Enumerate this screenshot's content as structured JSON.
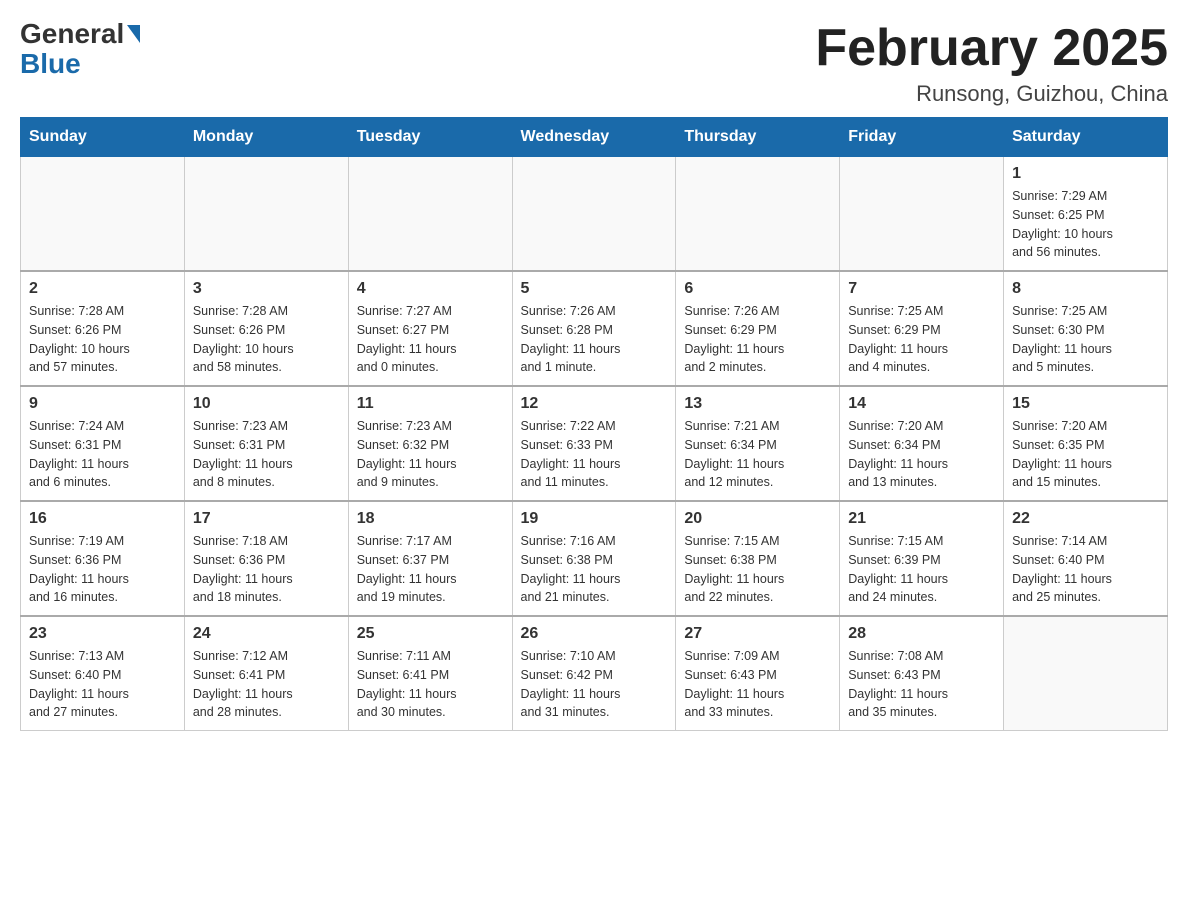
{
  "header": {
    "logo_general": "General",
    "logo_blue": "Blue",
    "title": "February 2025",
    "subtitle": "Runsong, Guizhou, China"
  },
  "days_of_week": [
    "Sunday",
    "Monday",
    "Tuesday",
    "Wednesday",
    "Thursday",
    "Friday",
    "Saturday"
  ],
  "weeks": [
    [
      {
        "day": "",
        "info": ""
      },
      {
        "day": "",
        "info": ""
      },
      {
        "day": "",
        "info": ""
      },
      {
        "day": "",
        "info": ""
      },
      {
        "day": "",
        "info": ""
      },
      {
        "day": "",
        "info": ""
      },
      {
        "day": "1",
        "info": "Sunrise: 7:29 AM\nSunset: 6:25 PM\nDaylight: 10 hours\nand 56 minutes."
      }
    ],
    [
      {
        "day": "2",
        "info": "Sunrise: 7:28 AM\nSunset: 6:26 PM\nDaylight: 10 hours\nand 57 minutes."
      },
      {
        "day": "3",
        "info": "Sunrise: 7:28 AM\nSunset: 6:26 PM\nDaylight: 10 hours\nand 58 minutes."
      },
      {
        "day": "4",
        "info": "Sunrise: 7:27 AM\nSunset: 6:27 PM\nDaylight: 11 hours\nand 0 minutes."
      },
      {
        "day": "5",
        "info": "Sunrise: 7:26 AM\nSunset: 6:28 PM\nDaylight: 11 hours\nand 1 minute."
      },
      {
        "day": "6",
        "info": "Sunrise: 7:26 AM\nSunset: 6:29 PM\nDaylight: 11 hours\nand 2 minutes."
      },
      {
        "day": "7",
        "info": "Sunrise: 7:25 AM\nSunset: 6:29 PM\nDaylight: 11 hours\nand 4 minutes."
      },
      {
        "day": "8",
        "info": "Sunrise: 7:25 AM\nSunset: 6:30 PM\nDaylight: 11 hours\nand 5 minutes."
      }
    ],
    [
      {
        "day": "9",
        "info": "Sunrise: 7:24 AM\nSunset: 6:31 PM\nDaylight: 11 hours\nand 6 minutes."
      },
      {
        "day": "10",
        "info": "Sunrise: 7:23 AM\nSunset: 6:31 PM\nDaylight: 11 hours\nand 8 minutes."
      },
      {
        "day": "11",
        "info": "Sunrise: 7:23 AM\nSunset: 6:32 PM\nDaylight: 11 hours\nand 9 minutes."
      },
      {
        "day": "12",
        "info": "Sunrise: 7:22 AM\nSunset: 6:33 PM\nDaylight: 11 hours\nand 11 minutes."
      },
      {
        "day": "13",
        "info": "Sunrise: 7:21 AM\nSunset: 6:34 PM\nDaylight: 11 hours\nand 12 minutes."
      },
      {
        "day": "14",
        "info": "Sunrise: 7:20 AM\nSunset: 6:34 PM\nDaylight: 11 hours\nand 13 minutes."
      },
      {
        "day": "15",
        "info": "Sunrise: 7:20 AM\nSunset: 6:35 PM\nDaylight: 11 hours\nand 15 minutes."
      }
    ],
    [
      {
        "day": "16",
        "info": "Sunrise: 7:19 AM\nSunset: 6:36 PM\nDaylight: 11 hours\nand 16 minutes."
      },
      {
        "day": "17",
        "info": "Sunrise: 7:18 AM\nSunset: 6:36 PM\nDaylight: 11 hours\nand 18 minutes."
      },
      {
        "day": "18",
        "info": "Sunrise: 7:17 AM\nSunset: 6:37 PM\nDaylight: 11 hours\nand 19 minutes."
      },
      {
        "day": "19",
        "info": "Sunrise: 7:16 AM\nSunset: 6:38 PM\nDaylight: 11 hours\nand 21 minutes."
      },
      {
        "day": "20",
        "info": "Sunrise: 7:15 AM\nSunset: 6:38 PM\nDaylight: 11 hours\nand 22 minutes."
      },
      {
        "day": "21",
        "info": "Sunrise: 7:15 AM\nSunset: 6:39 PM\nDaylight: 11 hours\nand 24 minutes."
      },
      {
        "day": "22",
        "info": "Sunrise: 7:14 AM\nSunset: 6:40 PM\nDaylight: 11 hours\nand 25 minutes."
      }
    ],
    [
      {
        "day": "23",
        "info": "Sunrise: 7:13 AM\nSunset: 6:40 PM\nDaylight: 11 hours\nand 27 minutes."
      },
      {
        "day": "24",
        "info": "Sunrise: 7:12 AM\nSunset: 6:41 PM\nDaylight: 11 hours\nand 28 minutes."
      },
      {
        "day": "25",
        "info": "Sunrise: 7:11 AM\nSunset: 6:41 PM\nDaylight: 11 hours\nand 30 minutes."
      },
      {
        "day": "26",
        "info": "Sunrise: 7:10 AM\nSunset: 6:42 PM\nDaylight: 11 hours\nand 31 minutes."
      },
      {
        "day": "27",
        "info": "Sunrise: 7:09 AM\nSunset: 6:43 PM\nDaylight: 11 hours\nand 33 minutes."
      },
      {
        "day": "28",
        "info": "Sunrise: 7:08 AM\nSunset: 6:43 PM\nDaylight: 11 hours\nand 35 minutes."
      },
      {
        "day": "",
        "info": ""
      }
    ]
  ]
}
